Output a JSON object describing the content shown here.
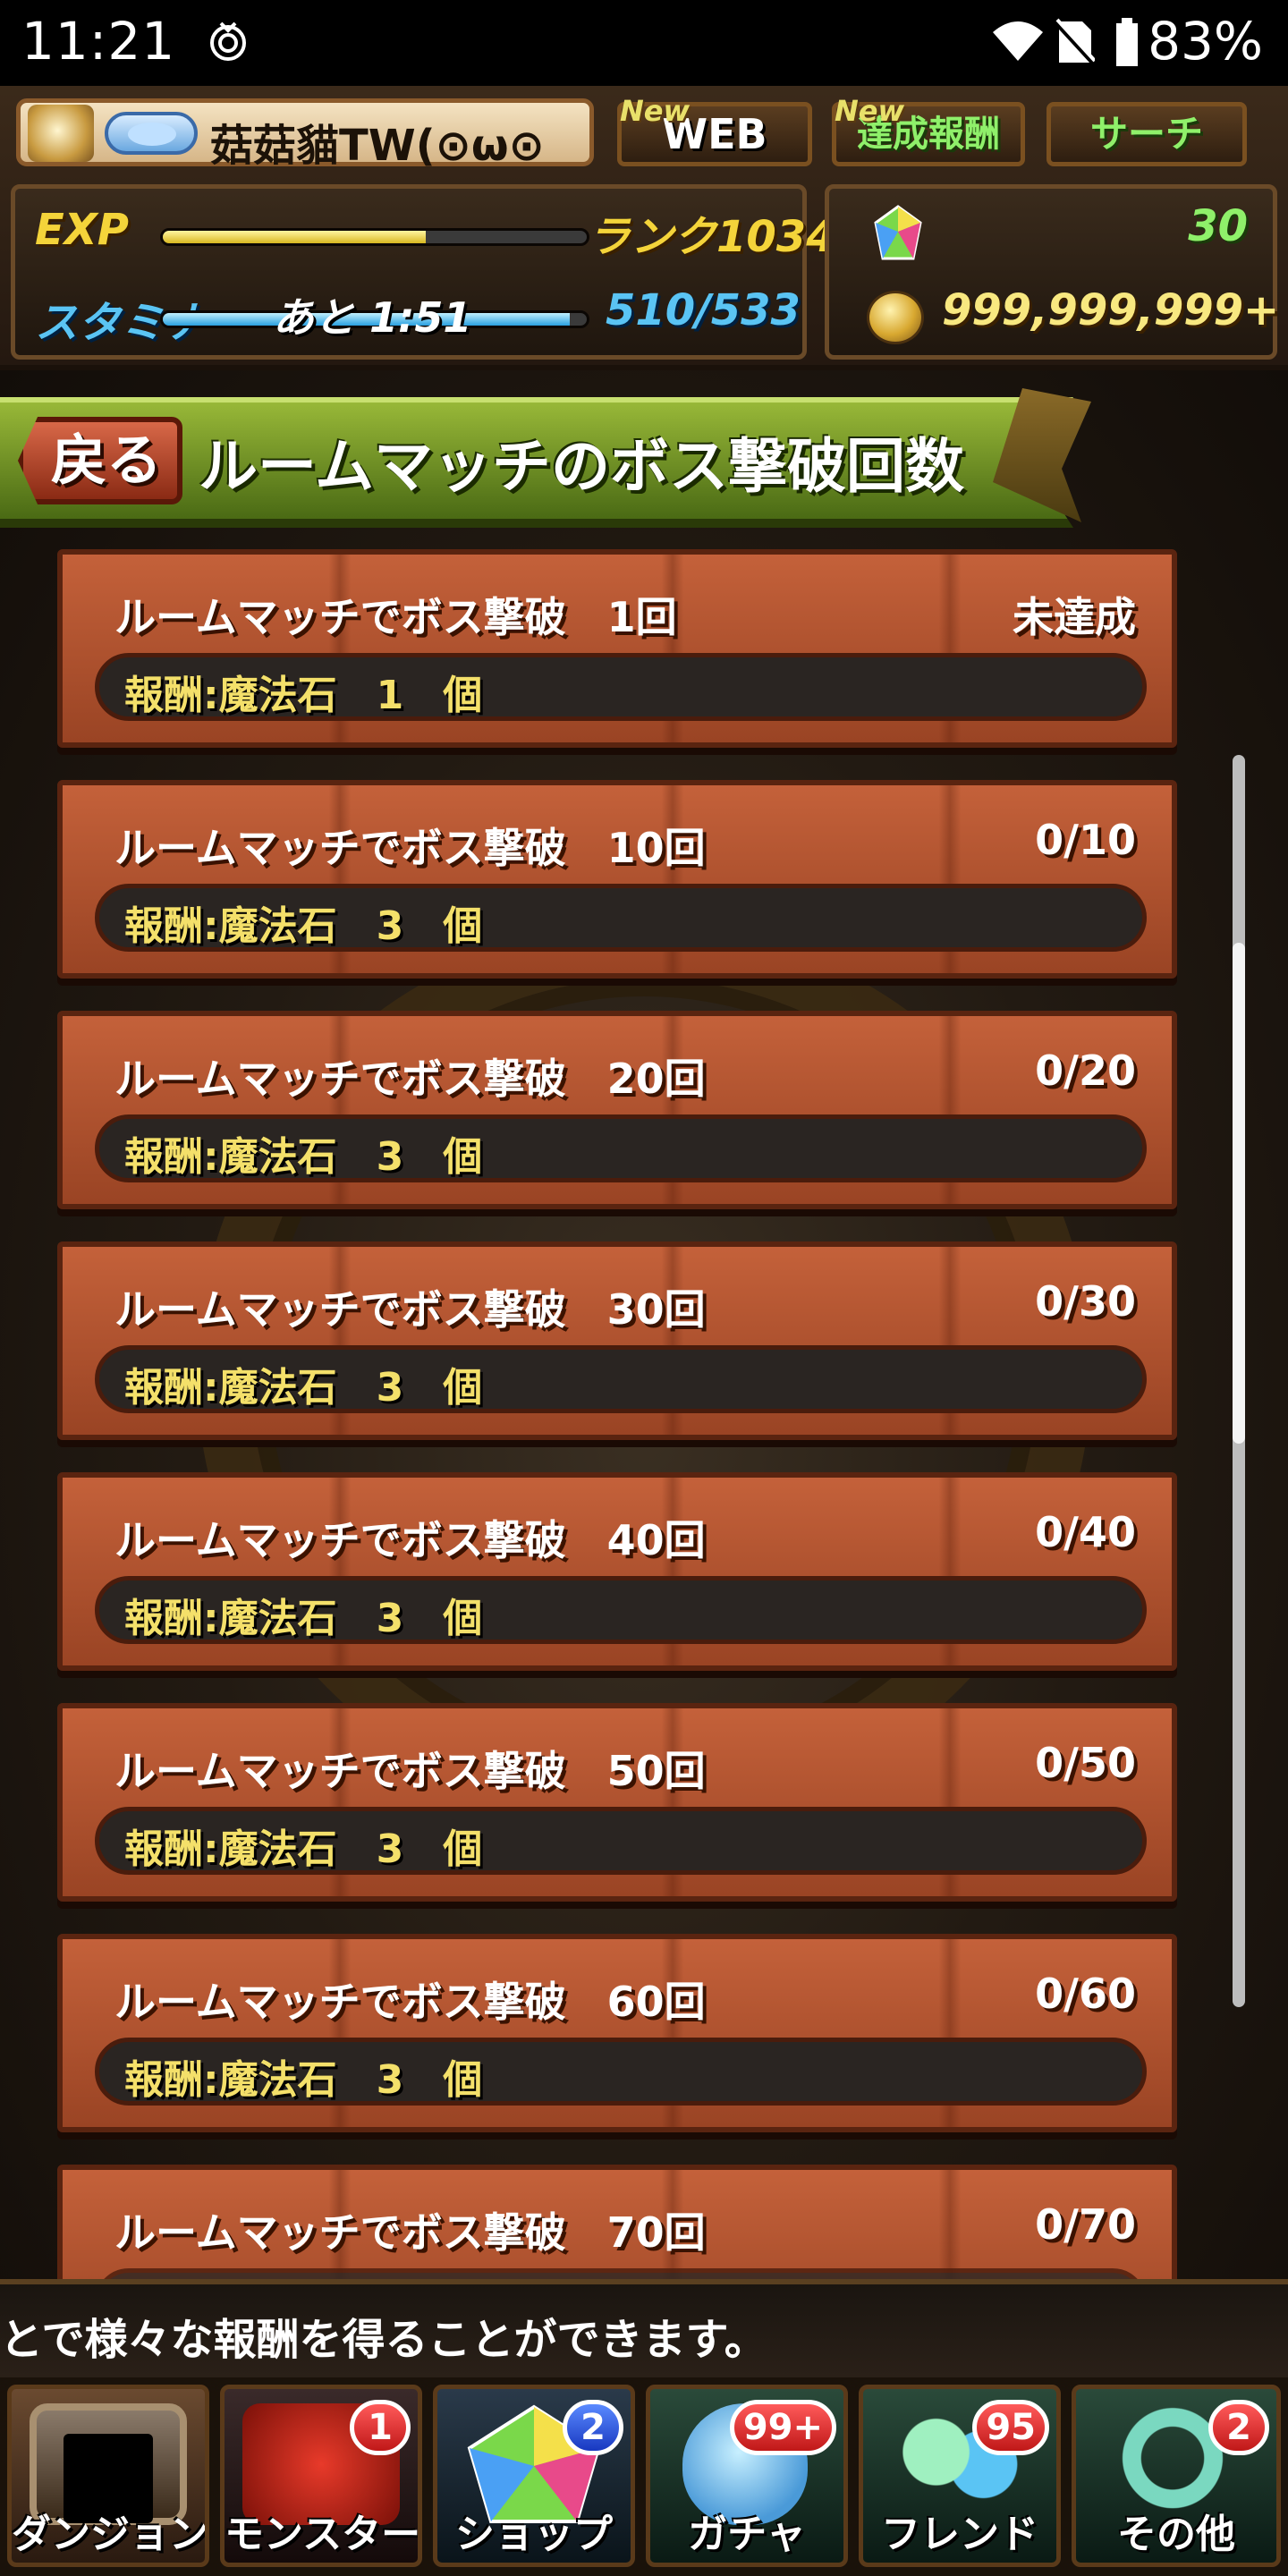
{
  "status_bar": {
    "time": "11:21",
    "battery": "83%",
    "icons": [
      "fingerprint-icon",
      "wifi-icon",
      "no-sim-icon",
      "battery-icon"
    ]
  },
  "header": {
    "player_name": "菇菇貓TW(⊙ω⊙",
    "buttons": {
      "web": {
        "label": "WEB",
        "new": "New"
      },
      "reward": {
        "label": "達成報酬",
        "new": "New"
      },
      "search": {
        "label": "サーチ"
      }
    },
    "exp_label": "EXP",
    "exp_progress": 0.62,
    "rank": "ランク1034",
    "stamina_label": "スタミナ",
    "stamina_timer": "あと 1:51",
    "stamina_progress": 0.96,
    "stamina_count": "510/533",
    "magic_stones": "30",
    "coins": "999,999,999+"
  },
  "page": {
    "back_label": "戻る",
    "title": "ルームマッチのボス撃破回数"
  },
  "missions": [
    {
      "title": "ルームマッチでボス撃破　1回",
      "progress": "未達成",
      "reward": "報酬:魔法石　1　個"
    },
    {
      "title": "ルームマッチでボス撃破　10回",
      "progress": "0/10",
      "reward": "報酬:魔法石　3　個"
    },
    {
      "title": "ルームマッチでボス撃破　20回",
      "progress": "0/20",
      "reward": "報酬:魔法石　3　個"
    },
    {
      "title": "ルームマッチでボス撃破　30回",
      "progress": "0/30",
      "reward": "報酬:魔法石　3　個"
    },
    {
      "title": "ルームマッチでボス撃破　40回",
      "progress": "0/40",
      "reward": "報酬:魔法石　3　個"
    },
    {
      "title": "ルームマッチでボス撃破　50回",
      "progress": "0/50",
      "reward": "報酬:魔法石　3　個"
    },
    {
      "title": "ルームマッチでボス撃破　60回",
      "progress": "0/60",
      "reward": "報酬:魔法石　3　個"
    },
    {
      "title": "ルームマッチでボス撃破　70回",
      "progress": "0/70",
      "reward": ""
    }
  ],
  "marquee": "とで様々な報酬を得ることができます。",
  "nav": [
    {
      "label": "ダンジョン",
      "badge": "",
      "badge_color": "#c01818"
    },
    {
      "label": "モンスター",
      "badge": "1",
      "badge_color": "#c01818"
    },
    {
      "label": "ショップ",
      "badge": "2",
      "badge_color": "#1838c0"
    },
    {
      "label": "ガチャ",
      "badge": "99+",
      "badge_color": "#c01818"
    },
    {
      "label": "フレンド",
      "badge": "95",
      "badge_color": "#c01818"
    },
    {
      "label": "その他",
      "badge": "2",
      "badge_color": "#c01818"
    }
  ]
}
